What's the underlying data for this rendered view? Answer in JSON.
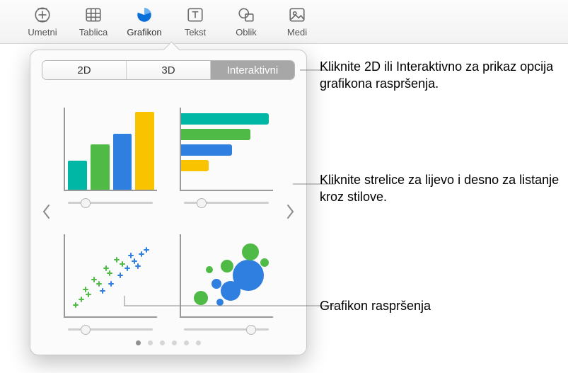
{
  "toolbar": {
    "insert": "Umetni",
    "table": "Tablica",
    "chart": "Grafikon",
    "text": "Tekst",
    "shape": "Oblik",
    "media": "Medi"
  },
  "segmented": {
    "tab2d": "2D",
    "tab3d": "3D",
    "tabInteractive": "Interaktivni"
  },
  "callouts": {
    "tabs": "Kliknite 2D ili Interaktivno za prikaz opcija grafikona raspršenja.",
    "arrows": "Kliknite strelice za lijevo i desno za listanje kroz stilove.",
    "scatter": "Grafikon raspršenja"
  },
  "pager": {
    "count": 6,
    "active": 0
  },
  "colors": {
    "teal": "#00b6a4",
    "green": "#4fbb46",
    "blue": "#2e7fe0",
    "yellow": "#f9c300"
  }
}
